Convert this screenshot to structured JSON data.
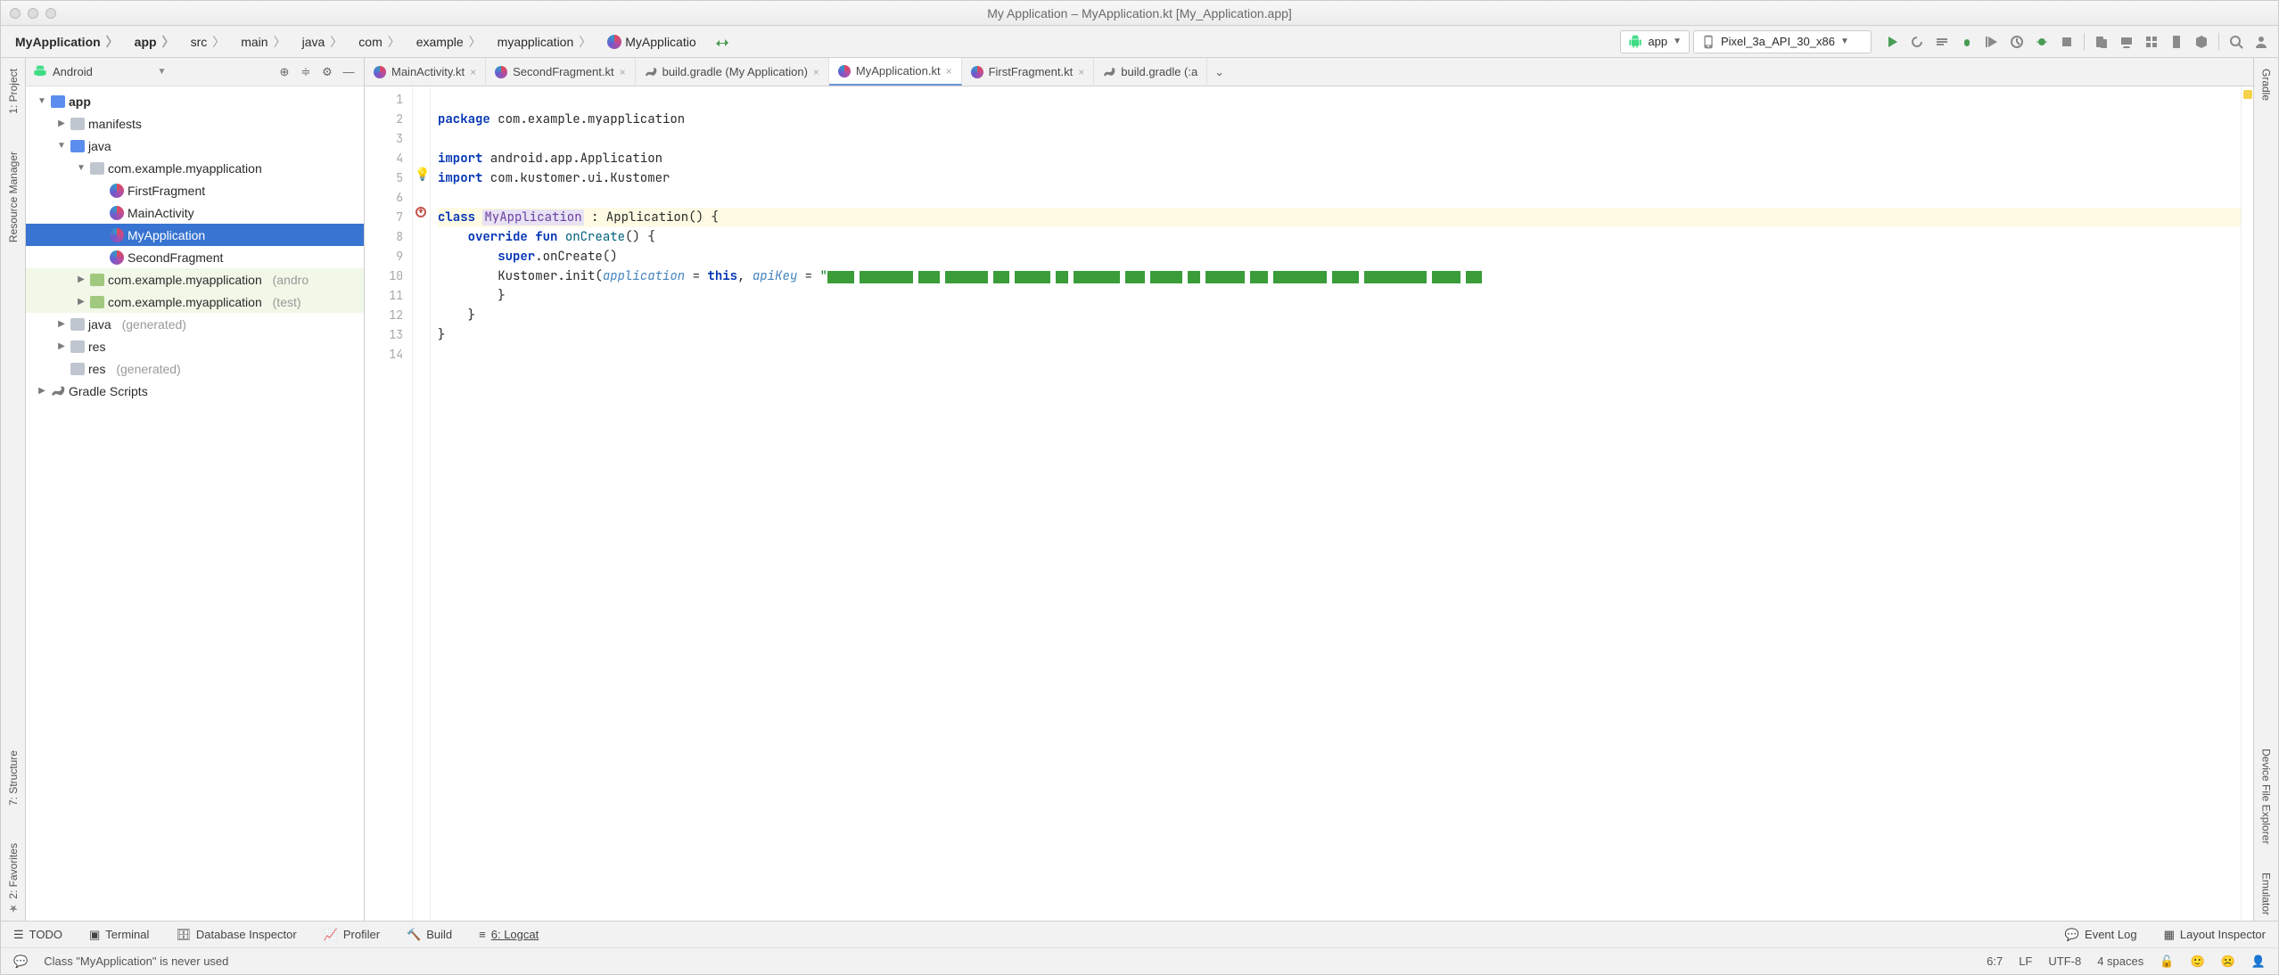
{
  "window": {
    "title": "My Application – MyApplication.kt [My_Application.app]"
  },
  "breadcrumbs": [
    "MyApplication",
    "app",
    "src",
    "main",
    "java",
    "com",
    "example",
    "myapplication",
    "MyApplicatio"
  ],
  "run_config": {
    "module": "app",
    "device": "Pixel_3a_API_30_x86"
  },
  "project_panel": {
    "mode": "Android",
    "tree": {
      "app": "app",
      "manifests": "manifests",
      "java": "java",
      "pkg": "com.example.myapplication",
      "first": "FirstFragment",
      "mainact": "MainActivity",
      "myapp": "MyApplication",
      "second": "SecondFragment",
      "pkg_android": "com.example.myapplication",
      "pkg_android_suffix": "(andro",
      "pkg_test": "com.example.myapplication",
      "pkg_test_suffix": "(test)",
      "java_gen": "java",
      "java_gen_suffix": "(generated)",
      "res": "res",
      "res_gen": "res",
      "res_gen_suffix": "(generated)",
      "gradle": "Gradle Scripts"
    }
  },
  "tabs": [
    {
      "label": "MainActivity.kt",
      "kind": "kt",
      "active": false
    },
    {
      "label": "SecondFragment.kt",
      "kind": "kt",
      "active": false
    },
    {
      "label": "build.gradle (My Application)",
      "kind": "gradle",
      "active": false
    },
    {
      "label": "MyApplication.kt",
      "kind": "kt",
      "active": true
    },
    {
      "label": "FirstFragment.kt",
      "kind": "kt",
      "active": false
    },
    {
      "label": "build.gradle (:a",
      "kind": "gradle",
      "active": false
    }
  ],
  "code": {
    "lines": [
      "1",
      "2",
      "3",
      "4",
      "5",
      "6",
      "7",
      "8",
      "9",
      "10",
      "11",
      "12",
      "13",
      "14"
    ],
    "l1_kw": "package",
    "l1_rest": " com.example.myapplication",
    "l3_kw": "import",
    "l3_rest": " android.app.Application",
    "l4_kw": "import",
    "l4_rest": " com.kustomer.ui.Kustomer",
    "l6_kw": "class ",
    "l6_name": "MyApplication",
    "l6_rest": " : Application() {",
    "l7_pad": "    ",
    "l7_kw1": "override",
    "l7_sp": " ",
    "l7_kw2": "fun",
    "l7_fn": " onCreate",
    "l7_rest": "() {",
    "l8_pad": "        ",
    "l8_kw": "super",
    "l8_rest": ".onCreate()",
    "l9_pad": "        ",
    "l9_a": "Kustomer.init(",
    "l9_p1": "application",
    "l9_eq": " = ",
    "l9_kw": "this",
    "l9_c": ", ",
    "l9_p2": "apiKey",
    "l9_eq2": " = ",
    "l9_str": "\"",
    "l10": "        }",
    "l11": "    }",
    "l12": "}"
  },
  "left_tools": {
    "project": "1: Project",
    "resmgr": "Resource Manager",
    "structure": "7: Structure",
    "favorites": "2: Favorites"
  },
  "right_tools": {
    "gradle": "Gradle",
    "devfile": "Device File Explorer",
    "emulator": "Emulator"
  },
  "bottom": {
    "todo": "TODO",
    "terminal": "Terminal",
    "dbinspect": "Database Inspector",
    "profiler": "Profiler",
    "build": "Build",
    "logcat": "6: Logcat",
    "eventlog": "Event Log",
    "layoutinsp": "Layout Inspector"
  },
  "status": {
    "hint": "Class \"MyApplication\" is never used",
    "pos": "6:7",
    "le": "LF",
    "enc": "UTF-8",
    "indent": "4 spaces"
  }
}
